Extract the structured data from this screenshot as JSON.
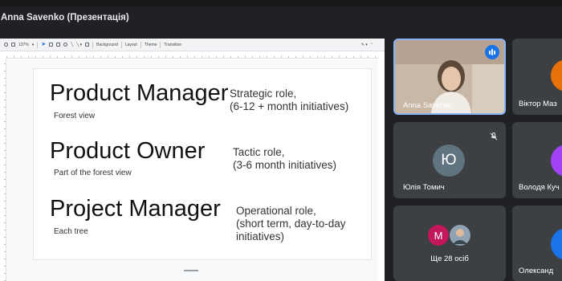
{
  "window": {
    "title": "Anna Savenko (Презентація)"
  },
  "toolbar": {
    "zoom": "137%",
    "background_label": "Background",
    "layout_label": "Layout",
    "theme_label": "Theme",
    "transition_label": "Transition"
  },
  "slide": {
    "rows": [
      {
        "title": "Product Manager",
        "subtitle": "Forest view",
        "desc_lines": [
          "Strategic role,",
          "(6-12 + month initiatives)"
        ]
      },
      {
        "title": "Product Owner",
        "subtitle": "Part of the forest view",
        "desc_lines": [
          "Tactic role,",
          "(3-6 month initiatives)"
        ]
      },
      {
        "title": "Project Manager",
        "subtitle": "Each tree",
        "desc_lines": [
          "Operational role,",
          "(short term, day-to-day",
          "initiatives)"
        ]
      }
    ]
  },
  "participants": {
    "speaker": {
      "name": "Anna Savenko"
    },
    "tiles": [
      {
        "name": "Віктор Маз",
        "avatar_color": "#e8710a"
      },
      {
        "name": "Юлія Томич",
        "initial": "Ю",
        "avatar_color": "#5f7380"
      },
      {
        "name": "Володя Куч",
        "avatar_color": "#a142f4"
      },
      {
        "name": "Олександ",
        "avatar_color": "#1a73e8"
      }
    ],
    "more": {
      "label": "Ще 28 осіб",
      "initial": "M",
      "avatar_color": "#c2185b"
    }
  },
  "colors": {
    "active_speaker_border": "#8ab4f8",
    "tile_bg": "#3c4043",
    "page_bg": "#202124"
  }
}
